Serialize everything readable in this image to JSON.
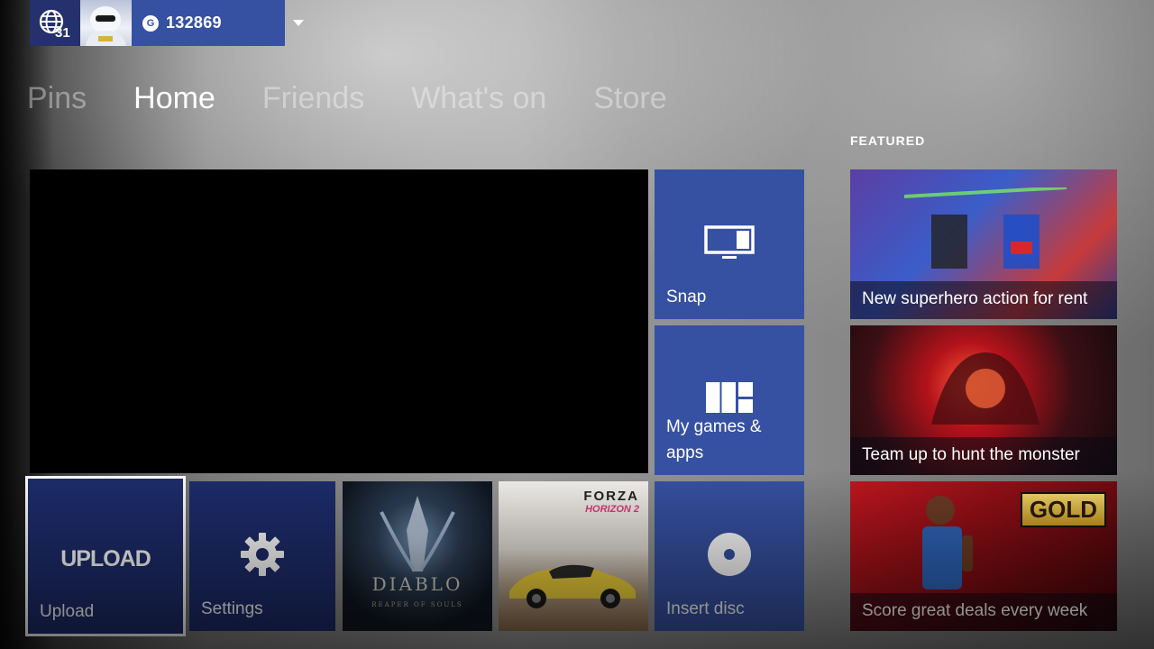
{
  "header": {
    "notifications": {
      "count": "31",
      "icon": "globe-icon"
    },
    "gamerscore": {
      "badge": "G",
      "value": "132869"
    },
    "dropdown_icon": "caret-down-icon"
  },
  "nav": {
    "tabs": [
      {
        "label": "Pins"
      },
      {
        "label": "Home",
        "active": true
      },
      {
        "label": "Friends"
      },
      {
        "label": "What's on"
      },
      {
        "label": "Store"
      }
    ]
  },
  "featured": {
    "title": "FEATURED",
    "items": [
      {
        "caption": "New superhero action for rent"
      },
      {
        "caption": "Team up to hunt the monster"
      },
      {
        "caption": "Score great deals every week",
        "badge": "GOLD"
      }
    ]
  },
  "tiles": {
    "snap": {
      "label": "Snap",
      "icon": "snap-icon"
    },
    "games": {
      "label": "My games &\napps",
      "icon": "games-apps-icon"
    },
    "disc": {
      "label": "Insert disc",
      "icon": "disc-icon"
    },
    "upload": {
      "big": "UPLOAD",
      "label": "Upload"
    },
    "settings": {
      "label": "Settings",
      "icon": "gear-icon"
    },
    "diablo": {
      "title": "DIABLO",
      "subtitle": "REAPER OF SOULS"
    },
    "forza": {
      "title": "FORZA",
      "subtitle": "HORIZON 2"
    }
  },
  "colors": {
    "tile_blue": "#3651a2",
    "tile_navy": "#1d2c6b",
    "focus_border": "#ffffff"
  }
}
